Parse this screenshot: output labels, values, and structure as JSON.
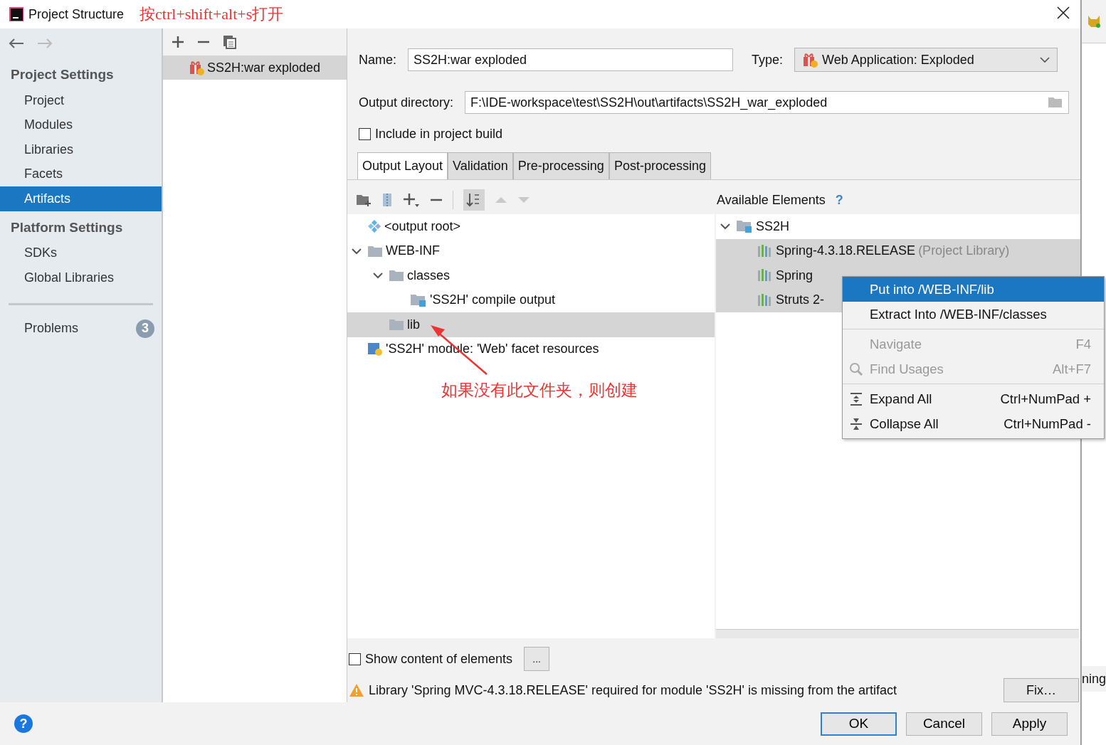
{
  "window": {
    "title": "Project Structure",
    "annotation": "按ctrl+shift+alt+s打开"
  },
  "sidebar": {
    "sections": [
      {
        "title": "Project Settings",
        "items": [
          {
            "label": "Project",
            "selected": false
          },
          {
            "label": "Modules",
            "selected": false
          },
          {
            "label": "Libraries",
            "selected": false
          },
          {
            "label": "Facets",
            "selected": false
          },
          {
            "label": "Artifacts",
            "selected": true
          }
        ]
      },
      {
        "title": "Platform Settings",
        "items": [
          {
            "label": "SDKs",
            "selected": false
          },
          {
            "label": "Global Libraries",
            "selected": false
          }
        ]
      }
    ],
    "problems": {
      "label": "Problems",
      "count": "3"
    }
  },
  "artifacts": [
    {
      "label": "SS2H:war exploded",
      "selected": true
    }
  ],
  "editor": {
    "name_label": "Name:",
    "name": "SS2H:war exploded",
    "type_label": "Type:",
    "type": "Web Application: Exploded",
    "output_label": "Output directory:",
    "output": "F:\\IDE-workspace\\test\\SS2H\\out\\artifacts\\SS2H_war_exploded",
    "include": {
      "label": "Include in project build",
      "checked": false
    },
    "tabs": [
      {
        "label": "Output Layout",
        "selected": true
      },
      {
        "label": "Validation",
        "selected": false
      },
      {
        "label": "Pre-processing",
        "selected": false
      },
      {
        "label": "Post-processing",
        "selected": false
      }
    ],
    "layout_tree": [
      {
        "label": "<output root>",
        "kind": "root",
        "selected": false
      },
      {
        "label": "WEB-INF",
        "kind": "folder",
        "expanded": true,
        "selected": false,
        "children": [
          {
            "label": "classes",
            "kind": "folder",
            "expanded": true,
            "selected": false,
            "children": [
              {
                "label": "'SS2H' compile output",
                "kind": "output",
                "selected": false
              }
            ]
          },
          {
            "label": "lib",
            "kind": "folder",
            "selected": true
          }
        ]
      },
      {
        "label": "'SS2H' module: 'Web' facet resources",
        "kind": "facet",
        "selected": false
      }
    ],
    "available_label": "Available Elements",
    "available_help": "?",
    "available_tree": [
      {
        "label": "SS2H",
        "kind": "module",
        "expanded": true,
        "selected": false,
        "children": [
          {
            "label": "Spring-4.3.18.RELEASE",
            "note": "(Project Library)",
            "kind": "library",
            "selected": true
          },
          {
            "label": "Spring",
            "kind": "library",
            "selected": true
          },
          {
            "label": "Struts 2-",
            "kind": "library",
            "selected": true
          }
        ]
      }
    ],
    "show_content": {
      "label": "Show content of elements",
      "checked": false
    },
    "more_button": "...",
    "warning": "Library 'Spring MVC-4.3.18.RELEASE' required for module 'SS2H' is missing from the artifact",
    "fix_button": "Fix…"
  },
  "context_menu": {
    "groups": [
      [
        {
          "label": "Put into /WEB-INF/lib",
          "kind": "plain",
          "selected": true,
          "disabled": false
        },
        {
          "label": "Extract Into /WEB-INF/classes",
          "kind": "plain",
          "selected": false,
          "disabled": false
        }
      ],
      [
        {
          "label": "Navigate",
          "shortcut": "F4",
          "kind": "plain",
          "selected": false,
          "disabled": true
        },
        {
          "label": "Find Usages",
          "shortcut": "Alt+F7",
          "kind": "search",
          "selected": false,
          "disabled": true
        }
      ],
      [
        {
          "label": "Expand All",
          "shortcut": "Ctrl+NumPad +",
          "kind": "expand",
          "selected": false,
          "disabled": false
        },
        {
          "label": "Collapse All",
          "shortcut": "Ctrl+NumPad -",
          "kind": "collapse",
          "selected": false,
          "disabled": false
        }
      ]
    ]
  },
  "annotation": {
    "text": "如果没有此文件夹，则创建"
  },
  "footer": {
    "help": "?",
    "buttons": [
      {
        "label": "OK",
        "default": true
      },
      {
        "label": "Cancel",
        "default": false
      },
      {
        "label": "Apply",
        "default": false
      }
    ]
  },
  "background_window": {
    "text": "ning"
  }
}
